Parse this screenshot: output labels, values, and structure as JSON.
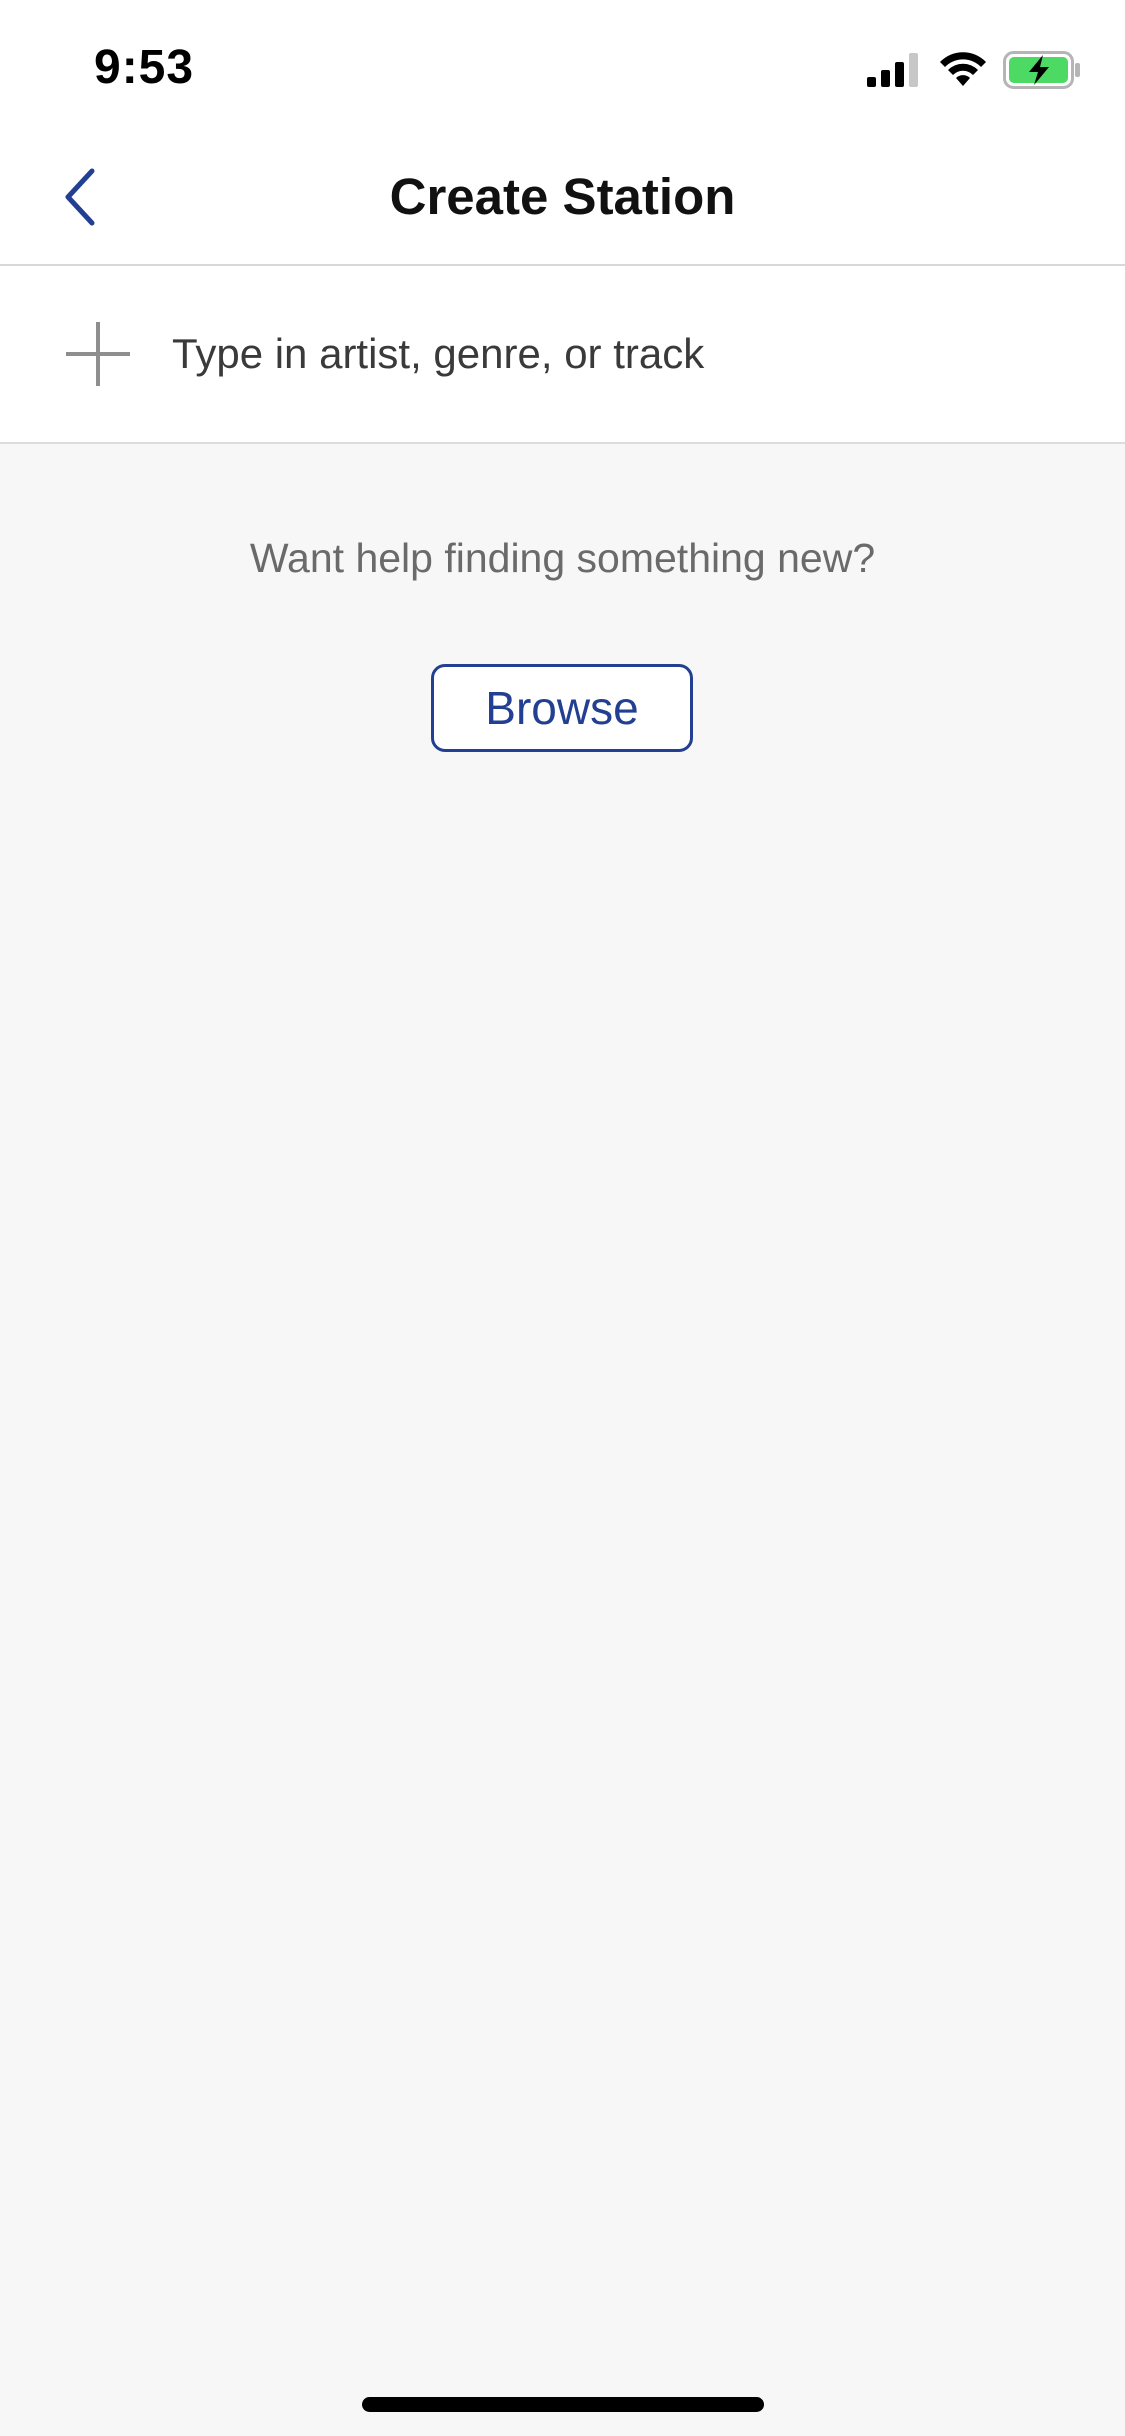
{
  "status_bar": {
    "time": "9:53",
    "icons": [
      "signal-icon",
      "wifi-icon",
      "battery-charging-icon"
    ],
    "battery_color": "#4cd964"
  },
  "nav": {
    "title": "Create Station",
    "back_icon": "chevron-left-icon"
  },
  "search": {
    "placeholder": "Type in artist, genre, or track",
    "value": "",
    "icon": "plus-icon"
  },
  "main": {
    "prompt": "Want help finding something new?",
    "browse_label": "Browse"
  },
  "colors": {
    "accent": "#223f91",
    "background": "#f7f7f7",
    "surface": "#ffffff",
    "muted_text": "#6a6a6a"
  }
}
